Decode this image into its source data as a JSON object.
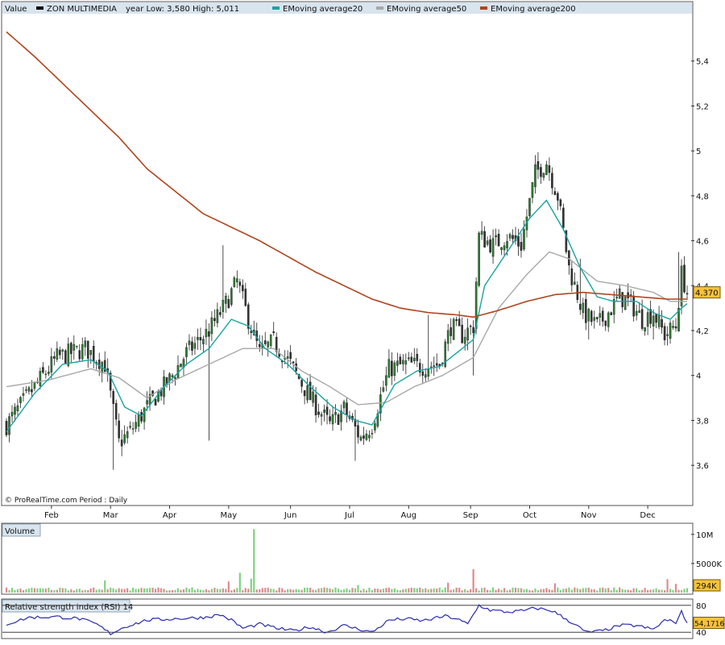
{
  "colors": {
    "bull": "#2e7d32",
    "bear": "#c62828",
    "candle_body_neutral": "#333333",
    "ema20": "#1aa3a3",
    "ema50": "#a8a8a8",
    "ema200": "#b0441c",
    "rsi": "#2a2ab0",
    "vol_up": "#7ed27e",
    "vol_down": "#e08a8a",
    "badge": "#f7c23a"
  },
  "chart_data": [
    {
      "type": "candlestick",
      "title": "",
      "value_label": "Value",
      "legend": [
        {
          "name": "ZON MULTIMEDIA",
          "color": "#000000"
        },
        {
          "name": "year Low: 3,580  High: 5,011",
          "color": ""
        },
        {
          "name": "EMoving average20",
          "color": "#1aa3a3"
        },
        {
          "name": "EMoving average50",
          "color": "#a8a8a8"
        },
        {
          "name": "EMoving average200",
          "color": "#b0441c"
        }
      ],
      "watermark": "© ProRealTime.com   Period : Daily",
      "last_value_label": "4,370",
      "ylim": [
        3.5,
        5.6
      ],
      "y_ticks": [
        "3,6",
        "3,8",
        "4",
        "4,2",
        "4,4",
        "4,6",
        "4,8",
        "5",
        "5,2",
        "5,4"
      ],
      "y_tick_values": [
        3.6,
        3.8,
        4.0,
        4.2,
        4.4,
        4.6,
        4.8,
        5.0,
        5.2,
        5.4
      ],
      "months": [
        "Feb",
        "Mar",
        "Apr",
        "May",
        "Jun",
        "Jul",
        "Aug",
        "Sep",
        "Oct",
        "Nov",
        "Dec"
      ],
      "month_index": [
        16,
        37,
        58,
        79,
        101,
        122,
        143,
        165,
        186,
        207,
        228
      ],
      "n_days": 243,
      "close_path": [
        [
          0,
          3.78
        ],
        [
          10,
          3.95
        ],
        [
          18,
          4.08
        ],
        [
          28,
          4.12
        ],
        [
          35,
          4.05
        ],
        [
          40,
          3.7
        ],
        [
          44,
          3.75
        ],
        [
          50,
          3.86
        ],
        [
          58,
          3.98
        ],
        [
          64,
          4.1
        ],
        [
          72,
          4.2
        ],
        [
          78,
          4.32
        ],
        [
          82,
          4.42
        ],
        [
          86,
          4.25
        ],
        [
          90,
          4.1
        ],
        [
          95,
          4.15
        ],
        [
          101,
          4.05
        ],
        [
          108,
          3.9
        ],
        [
          115,
          3.78
        ],
        [
          120,
          3.85
        ],
        [
          126,
          3.72
        ],
        [
          130,
          3.78
        ],
        [
          136,
          4.03
        ],
        [
          142,
          4.05
        ],
        [
          148,
          4.04
        ],
        [
          154,
          4.05
        ],
        [
          158,
          4.22
        ],
        [
          162,
          4.18
        ],
        [
          166,
          4.22
        ],
        [
          168,
          4.62
        ],
        [
          173,
          4.58
        ],
        [
          178,
          4.62
        ],
        [
          183,
          4.58
        ],
        [
          188,
          4.9
        ],
        [
          192,
          4.95
        ],
        [
          196,
          4.8
        ],
        [
          200,
          4.48
        ],
        [
          205,
          4.28
        ],
        [
          210,
          4.22
        ],
        [
          214,
          4.28
        ],
        [
          218,
          4.35
        ],
        [
          222,
          4.32
        ],
        [
          226,
          4.25
        ],
        [
          230,
          4.28
        ],
        [
          234,
          4.18
        ],
        [
          238,
          4.22
        ],
        [
          240,
          4.45
        ],
        [
          242,
          4.37
        ]
      ],
      "ema20_path": [
        [
          0,
          3.75
        ],
        [
          10,
          3.92
        ],
        [
          20,
          4.05
        ],
        [
          30,
          4.07
        ],
        [
          36,
          4.02
        ],
        [
          42,
          3.86
        ],
        [
          48,
          3.82
        ],
        [
          56,
          3.95
        ],
        [
          64,
          4.05
        ],
        [
          72,
          4.12
        ],
        [
          80,
          4.25
        ],
        [
          86,
          4.22
        ],
        [
          92,
          4.12
        ],
        [
          100,
          4.05
        ],
        [
          108,
          3.95
        ],
        [
          116,
          3.86
        ],
        [
          124,
          3.8
        ],
        [
          130,
          3.78
        ],
        [
          138,
          3.96
        ],
        [
          146,
          4.02
        ],
        [
          154,
          4.04
        ],
        [
          162,
          4.12
        ],
        [
          166,
          4.16
        ],
        [
          170,
          4.4
        ],
        [
          178,
          4.55
        ],
        [
          186,
          4.7
        ],
        [
          192,
          4.78
        ],
        [
          198,
          4.65
        ],
        [
          204,
          4.48
        ],
        [
          210,
          4.35
        ],
        [
          216,
          4.33
        ],
        [
          224,
          4.33
        ],
        [
          230,
          4.28
        ],
        [
          236,
          4.25
        ],
        [
          240,
          4.3
        ],
        [
          242,
          4.32
        ]
      ],
      "ema50_path": [
        [
          0,
          3.95
        ],
        [
          15,
          3.98
        ],
        [
          30,
          4.03
        ],
        [
          40,
          3.99
        ],
        [
          50,
          3.9
        ],
        [
          60,
          3.98
        ],
        [
          72,
          4.05
        ],
        [
          84,
          4.12
        ],
        [
          95,
          4.12
        ],
        [
          105,
          4.02
        ],
        [
          115,
          3.95
        ],
        [
          125,
          3.87
        ],
        [
          135,
          3.88
        ],
        [
          145,
          3.95
        ],
        [
          155,
          4.0
        ],
        [
          166,
          4.08
        ],
        [
          175,
          4.3
        ],
        [
          185,
          4.45
        ],
        [
          193,
          4.55
        ],
        [
          200,
          4.52
        ],
        [
          210,
          4.42
        ],
        [
          220,
          4.4
        ],
        [
          230,
          4.37
        ],
        [
          236,
          4.33
        ],
        [
          242,
          4.33
        ]
      ],
      "ema200_path": [
        [
          0,
          5.53
        ],
        [
          10,
          5.42
        ],
        [
          20,
          5.3
        ],
        [
          30,
          5.18
        ],
        [
          40,
          5.06
        ],
        [
          50,
          4.92
        ],
        [
          60,
          4.82
        ],
        [
          70,
          4.72
        ],
        [
          80,
          4.66
        ],
        [
          90,
          4.6
        ],
        [
          100,
          4.53
        ],
        [
          110,
          4.46
        ],
        [
          120,
          4.4
        ],
        [
          130,
          4.34
        ],
        [
          140,
          4.3
        ],
        [
          150,
          4.28
        ],
        [
          160,
          4.27
        ],
        [
          166,
          4.26
        ],
        [
          175,
          4.29
        ],
        [
          185,
          4.33
        ],
        [
          195,
          4.36
        ],
        [
          205,
          4.37
        ],
        [
          215,
          4.36
        ],
        [
          225,
          4.35
        ],
        [
          235,
          4.34
        ],
        [
          242,
          4.34
        ]
      ],
      "high_spikes": [
        [
          77,
          4.58
        ],
        [
          150,
          4.27
        ],
        [
          204,
          4.52
        ],
        [
          239,
          4.55
        ]
      ],
      "low_spikes": [
        [
          38,
          3.58
        ],
        [
          72,
          3.71
        ],
        [
          124,
          3.62
        ],
        [
          166,
          4.0
        ],
        [
          207,
          4.16
        ],
        [
          230,
          4.16
        ]
      ]
    },
    {
      "type": "bar",
      "title": "Volume",
      "y_ticks": [
        "10M",
        "5000K"
      ],
      "y_tick_values": [
        10000000,
        5000000
      ],
      "ylim": [
        0,
        11500000
      ],
      "last_value_label": "294K",
      "spikes": [
        [
          35,
          2100000
        ],
        [
          79,
          1900000
        ],
        [
          83,
          3400000
        ],
        [
          88,
          10900000
        ],
        [
          87,
          2400000
        ],
        [
          125,
          1300000
        ],
        [
          157,
          1700000
        ],
        [
          166,
          4000000
        ],
        [
          195,
          1600000
        ],
        [
          218,
          900000
        ],
        [
          235,
          2300000
        ],
        [
          238,
          1500000
        ]
      ],
      "baseline": 600000
    },
    {
      "type": "line",
      "title": "Relative strength index (RSI) 14",
      "y_ticks": [
        "80",
        "40"
      ],
      "y_tick_values": [
        80,
        40
      ],
      "ylim": [
        33,
        87
      ],
      "last_value_label": "54,1716",
      "rsi_path": [
        [
          0,
          52
        ],
        [
          8,
          62
        ],
        [
          18,
          63
        ],
        [
          26,
          60
        ],
        [
          32,
          52
        ],
        [
          37,
          38
        ],
        [
          42,
          48
        ],
        [
          50,
          58
        ],
        [
          60,
          60
        ],
        [
          70,
          62
        ],
        [
          76,
          66
        ],
        [
          80,
          58
        ],
        [
          84,
          46
        ],
        [
          90,
          52
        ],
        [
          96,
          46
        ],
        [
          102,
          42
        ],
        [
          108,
          48
        ],
        [
          114,
          40
        ],
        [
          120,
          50
        ],
        [
          126,
          44
        ],
        [
          130,
          40
        ],
        [
          136,
          58
        ],
        [
          142,
          60
        ],
        [
          148,
          57
        ],
        [
          156,
          64
        ],
        [
          160,
          60
        ],
        [
          164,
          52
        ],
        [
          168,
          80
        ],
        [
          172,
          73
        ],
        [
          178,
          70
        ],
        [
          184,
          72
        ],
        [
          188,
          76
        ],
        [
          194,
          72
        ],
        [
          198,
          62
        ],
        [
          202,
          52
        ],
        [
          206,
          40
        ],
        [
          212,
          42
        ],
        [
          218,
          50
        ],
        [
          224,
          50
        ],
        [
          230,
          44
        ],
        [
          234,
          58
        ],
        [
          238,
          55
        ],
        [
          240,
          70
        ],
        [
          242,
          54
        ]
      ]
    }
  ]
}
